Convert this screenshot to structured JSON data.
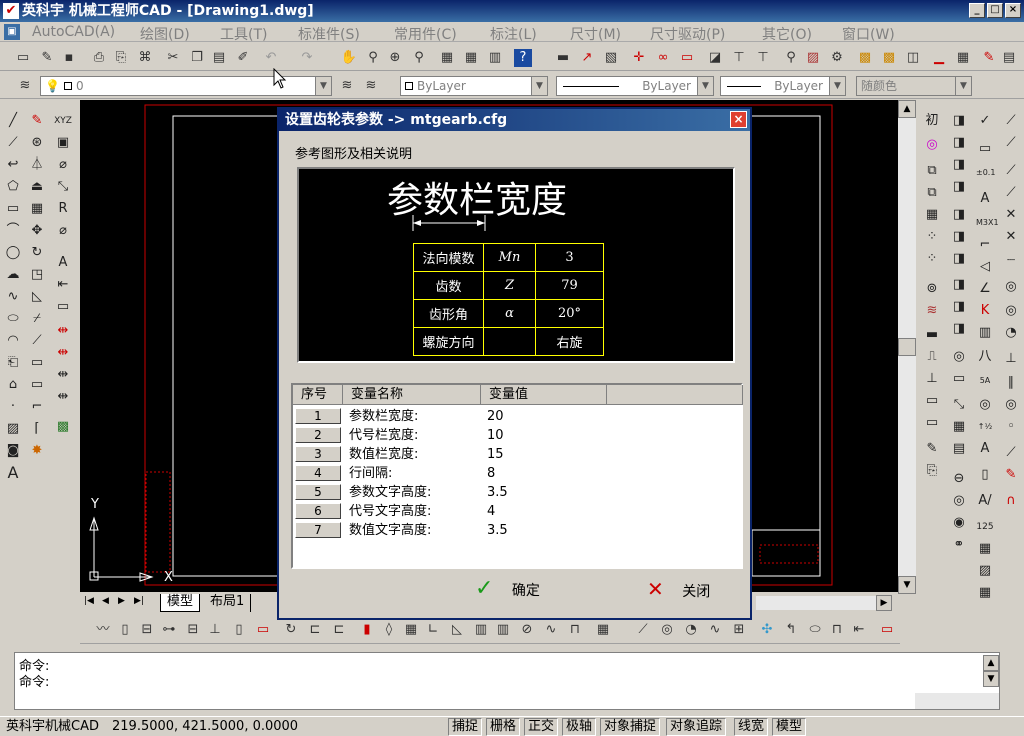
{
  "window": {
    "title": "英科宇 机械工程师CAD - [Drawing1.dwg]",
    "app_icon": "app-logo-icon",
    "min_label": "_",
    "max_label": "□",
    "close_label": "×"
  },
  "menu": [
    "AutoCAD(A)",
    "绘图(D)",
    "工具(T)",
    "标准件(S)",
    "常用件(C)",
    "标注(L)",
    "尺寸(M)",
    "尺寸驱动(P)",
    "其它(O)",
    "窗口(W)"
  ],
  "layer_toolbar": {
    "layer_value": "0",
    "color_value": "ByLayer",
    "linetype_value": "ByLayer",
    "lineweight_value": "ByLayer",
    "plotstyle_value": "随颜色"
  },
  "dialog": {
    "title": "设置齿轮表参数 -> mtgearb.cfg",
    "close_label": "×",
    "section_label": "参考图形及相关说明",
    "preview": {
      "heading": "参数栏宽度",
      "rows": [
        [
          "法向模数",
          "Mn",
          "3"
        ],
        [
          "齿数",
          "Z",
          "79"
        ],
        [
          "齿形角",
          "α",
          "20°"
        ],
        [
          "螺旋方向",
          "",
          "右旋"
        ]
      ]
    },
    "grid": {
      "headers": [
        "序号",
        "变量名称",
        "变量值"
      ],
      "rows": [
        {
          "no": "1",
          "name": "参数栏宽度:",
          "value": "20"
        },
        {
          "no": "2",
          "name": "代号栏宽度:",
          "value": "10"
        },
        {
          "no": "3",
          "name": "数值栏宽度:",
          "value": "15"
        },
        {
          "no": "4",
          "name": "行间隔:",
          "value": "8"
        },
        {
          "no": "5",
          "name": "参数文字高度:",
          "value": "3.5"
        },
        {
          "no": "6",
          "name": "代号文字高度:",
          "value": "4"
        },
        {
          "no": "7",
          "name": "数值文字高度:",
          "value": "3.5"
        }
      ]
    },
    "ok_label": "确定",
    "cancel_label": "关闭"
  },
  "tabs": [
    "模型",
    "布局1"
  ],
  "axis": {
    "y": "Y",
    "x": "X"
  },
  "command": {
    "line1": "命令:",
    "line2": "命令:"
  },
  "status": {
    "app_name": "英科宇机械CAD",
    "coords": "219.5000,  421.5000,  0.0000",
    "toggles": [
      "捕捉",
      "栅格",
      "正交",
      "极轴",
      "对象捕捉",
      "对象追踪",
      "线宽",
      "模型"
    ]
  }
}
